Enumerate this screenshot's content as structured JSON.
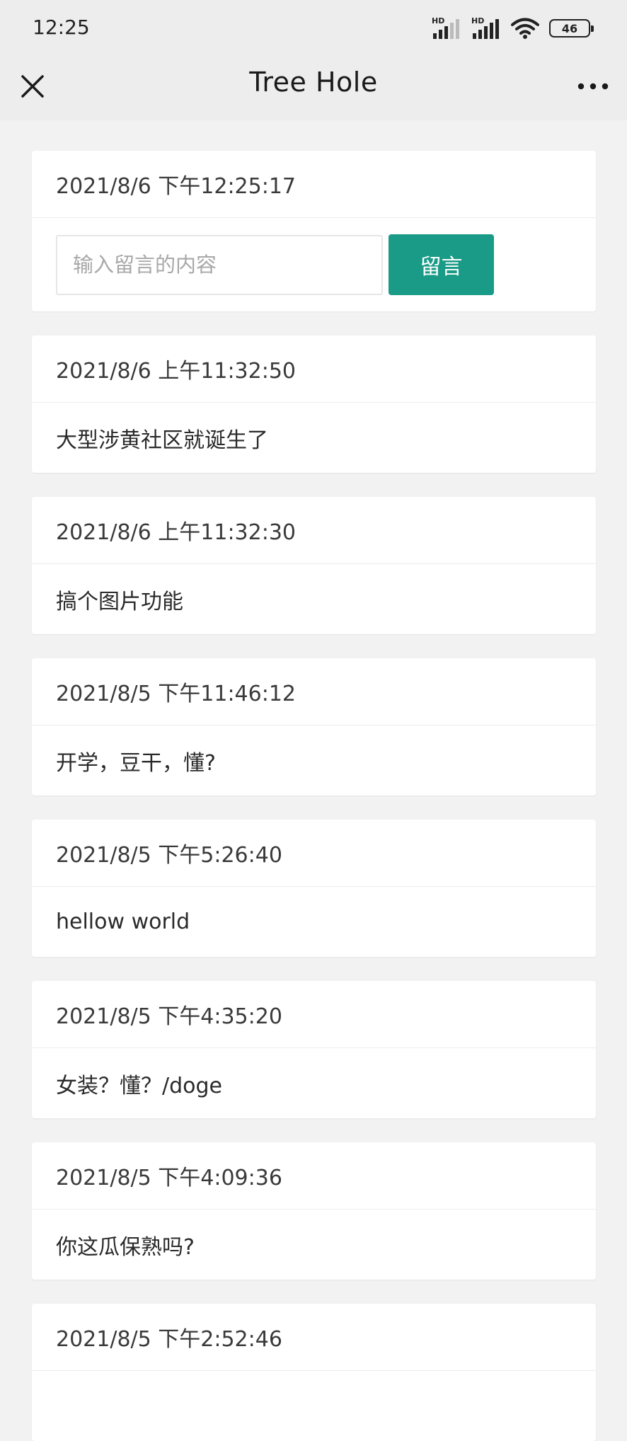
{
  "status_bar": {
    "time": "12:25",
    "signal_1_label": "HD",
    "signal_2_label": "HD",
    "wifi_icon": "wifi-icon",
    "battery_level": "46"
  },
  "nav": {
    "title": "Tree Hole",
    "close_icon": "close-icon",
    "more_icon": "more-icon"
  },
  "compose": {
    "timestamp": "2021/8/6 下午12:25:17",
    "placeholder": "输入留言的内容",
    "submit_label": "留言"
  },
  "messages": [
    {
      "time": "2021/8/6 上午11:32:50",
      "text": "大型涉黄社区就诞生了"
    },
    {
      "time": "2021/8/6 上午11:32:30",
      "text": "搞个图片功能"
    },
    {
      "time": "2021/8/5 下午11:46:12",
      "text": "开学，豆干，懂?"
    },
    {
      "time": "2021/8/5 下午5:26:40",
      "text": "hellow world"
    },
    {
      "time": "2021/8/5 下午4:35:20",
      "text": "女装？懂？/doge"
    },
    {
      "time": "2021/8/5 下午4:09:36",
      "text": "你这瓜保熟吗?"
    },
    {
      "time": "2021/8/5 下午2:52:46",
      "text": ""
    }
  ],
  "colors": {
    "accent": "#1a9b87",
    "background": "#f2f2f2",
    "header": "#ededed"
  }
}
